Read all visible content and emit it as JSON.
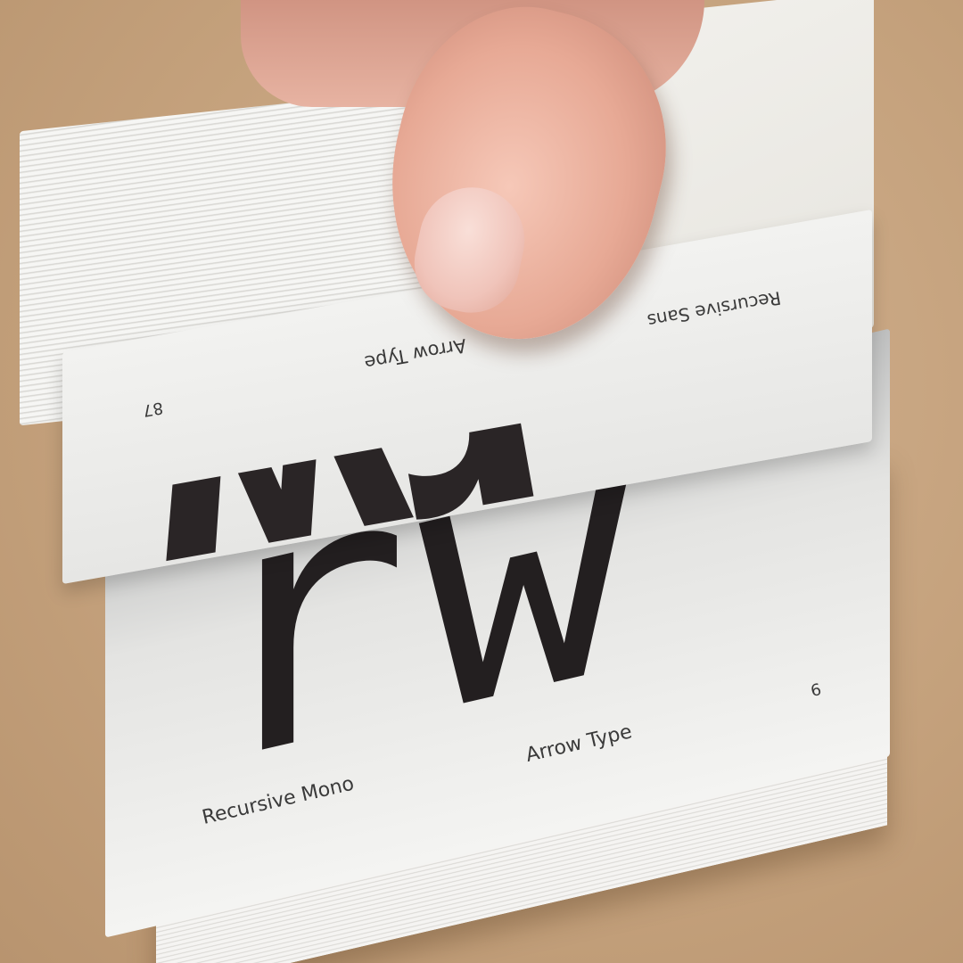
{
  "scene": {
    "subject": "flipbook",
    "bottom_page": {
      "glyphs": "rw",
      "font_name": "Recursive Mono",
      "brand": "Arrow Type",
      "page_number": "6"
    },
    "top_page": {
      "glyphs": "rw",
      "font_name": "Recursive Sans",
      "brand": "Arrow Type",
      "page_number": "87"
    }
  },
  "colors": {
    "table": "#c9a783",
    "paper": "#f2f2f0",
    "ink": "#231f20",
    "skin": "#e7a995"
  }
}
